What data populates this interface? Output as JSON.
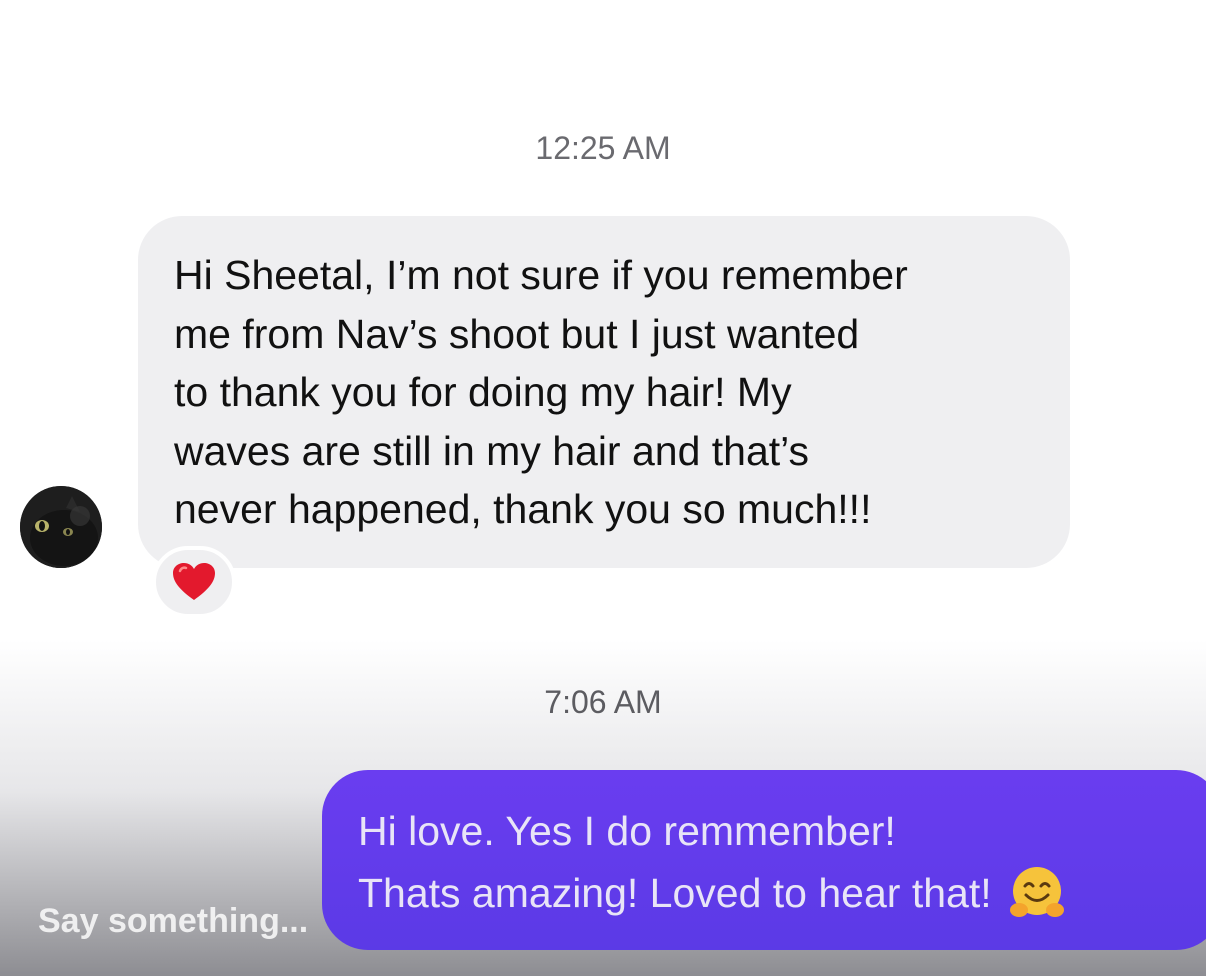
{
  "conversation": {
    "messages": [
      {
        "timestamp": "12:25 AM",
        "sender": "other",
        "text": "Hi Sheetal, I’m not sure if you remember\nme from Nav’s shoot but I just wanted\nto thank you for doing my hair! My\nwaves are still in my hair and that’s\nnever happened, thank you so much!!!",
        "reaction_icon": "red-heart-icon"
      },
      {
        "timestamp": "7:06 AM",
        "sender": "me",
        "lines": [
          "Hi love. Yes I do remmember!",
          "Thats amazing! Loved to hear that!"
        ],
        "emoji_icon": "hugging-face-emoji"
      }
    ]
  },
  "composer": {
    "placeholder": "Say something..."
  },
  "colors": {
    "incoming_bubble": "#efeff1",
    "outgoing_bubble": "#5b3ae6",
    "heart": "#e3192d"
  }
}
